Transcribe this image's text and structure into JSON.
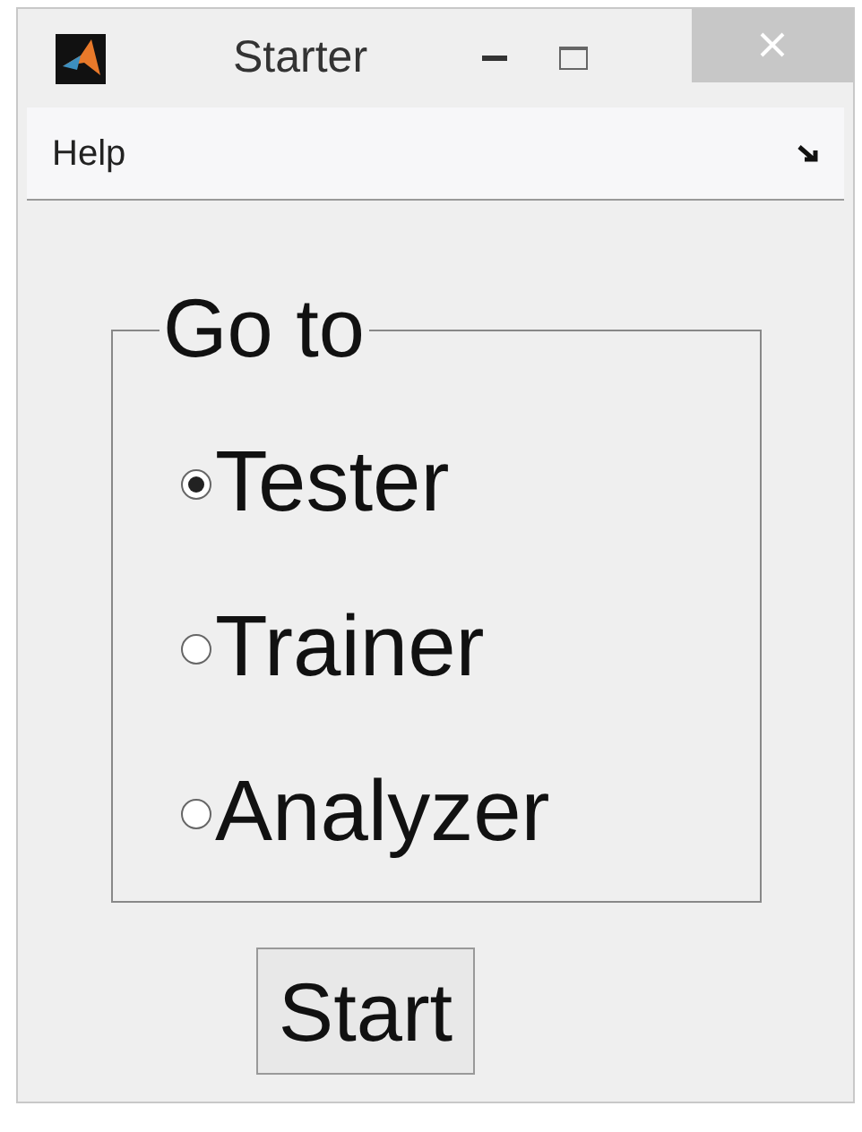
{
  "window": {
    "title": "Starter"
  },
  "menu": [
    {
      "label": "Help"
    }
  ],
  "group": {
    "title": "Go to",
    "options": [
      {
        "label": "Tester",
        "selected": true
      },
      {
        "label": "Trainer",
        "selected": false
      },
      {
        "label": "Analyzer",
        "selected": false
      }
    ]
  },
  "button": {
    "label": "Start"
  }
}
